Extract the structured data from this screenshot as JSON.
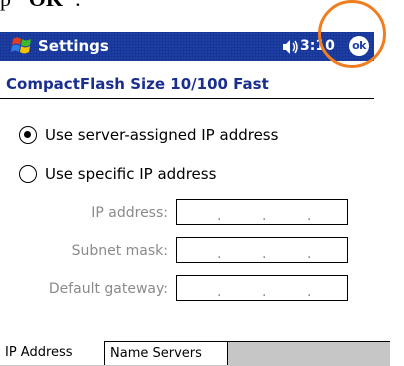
{
  "caption": {
    "prefix": "p ",
    "bold": "\"OK\"",
    "suffix": "."
  },
  "titlebar": {
    "title": "Settings",
    "clock": "3:10",
    "ok_label": "ok",
    "start_icon": "windows-flag-icon",
    "volume_icon": "speaker-icon"
  },
  "subtitle": "CompactFlash Size 10/100 Fast",
  "radios": [
    {
      "label": "Use server-assigned IP address",
      "selected": true
    },
    {
      "label": "Use specific IP address",
      "selected": false
    }
  ],
  "fields": {
    "ip_address": {
      "label": "IP address:",
      "value": ". . ."
    },
    "subnet_mask": {
      "label": "Subnet mask:",
      "value": ". . ."
    },
    "default_gateway": {
      "label": "Default gateway:",
      "value": ". . ."
    }
  },
  "tabs": [
    {
      "label": "IP Address",
      "active": true
    },
    {
      "label": "Name Servers",
      "active": false
    }
  ],
  "colors": {
    "titlebar": "#1f3fa6",
    "highlight": "#f07d1e",
    "subtitle": "#1a2e8f",
    "disabled_text": "#8a8a8a"
  }
}
